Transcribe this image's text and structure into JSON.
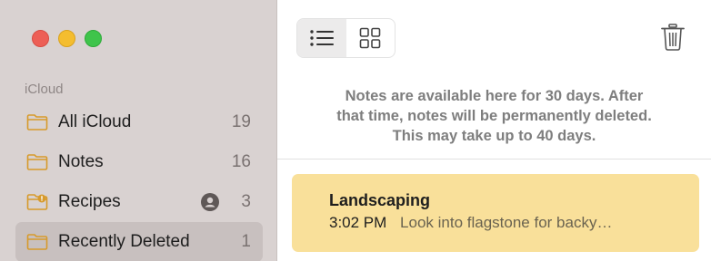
{
  "sidebar": {
    "section_label": "iCloud",
    "items": [
      {
        "label": "All iCloud",
        "count": "19",
        "icon": "folder-icon"
      },
      {
        "label": "Notes",
        "count": "16",
        "icon": "folder-icon"
      },
      {
        "label": "Recipes",
        "count": "3",
        "icon": "shared-folder-icon",
        "shared": true
      },
      {
        "label": "Recently Deleted",
        "count": "1",
        "icon": "folder-icon",
        "selected": true
      }
    ]
  },
  "toolbar": {
    "views": [
      "list-view",
      "gallery-view"
    ],
    "active_view": "list-view",
    "trash_icon": "trash-icon"
  },
  "main": {
    "info_lines": [
      "Notes are available here for 30 days. After",
      "that time, notes will be permanently deleted.",
      "This may take up to 40 days."
    ],
    "notes": [
      {
        "title": "Landscaping",
        "time": "3:02 PM",
        "preview": "Look into flagstone for backy…"
      }
    ]
  },
  "colors": {
    "accent_folder": "#d79a2b",
    "note_highlight": "#f9e09a",
    "sidebar_bg": "#d9d2d1"
  }
}
